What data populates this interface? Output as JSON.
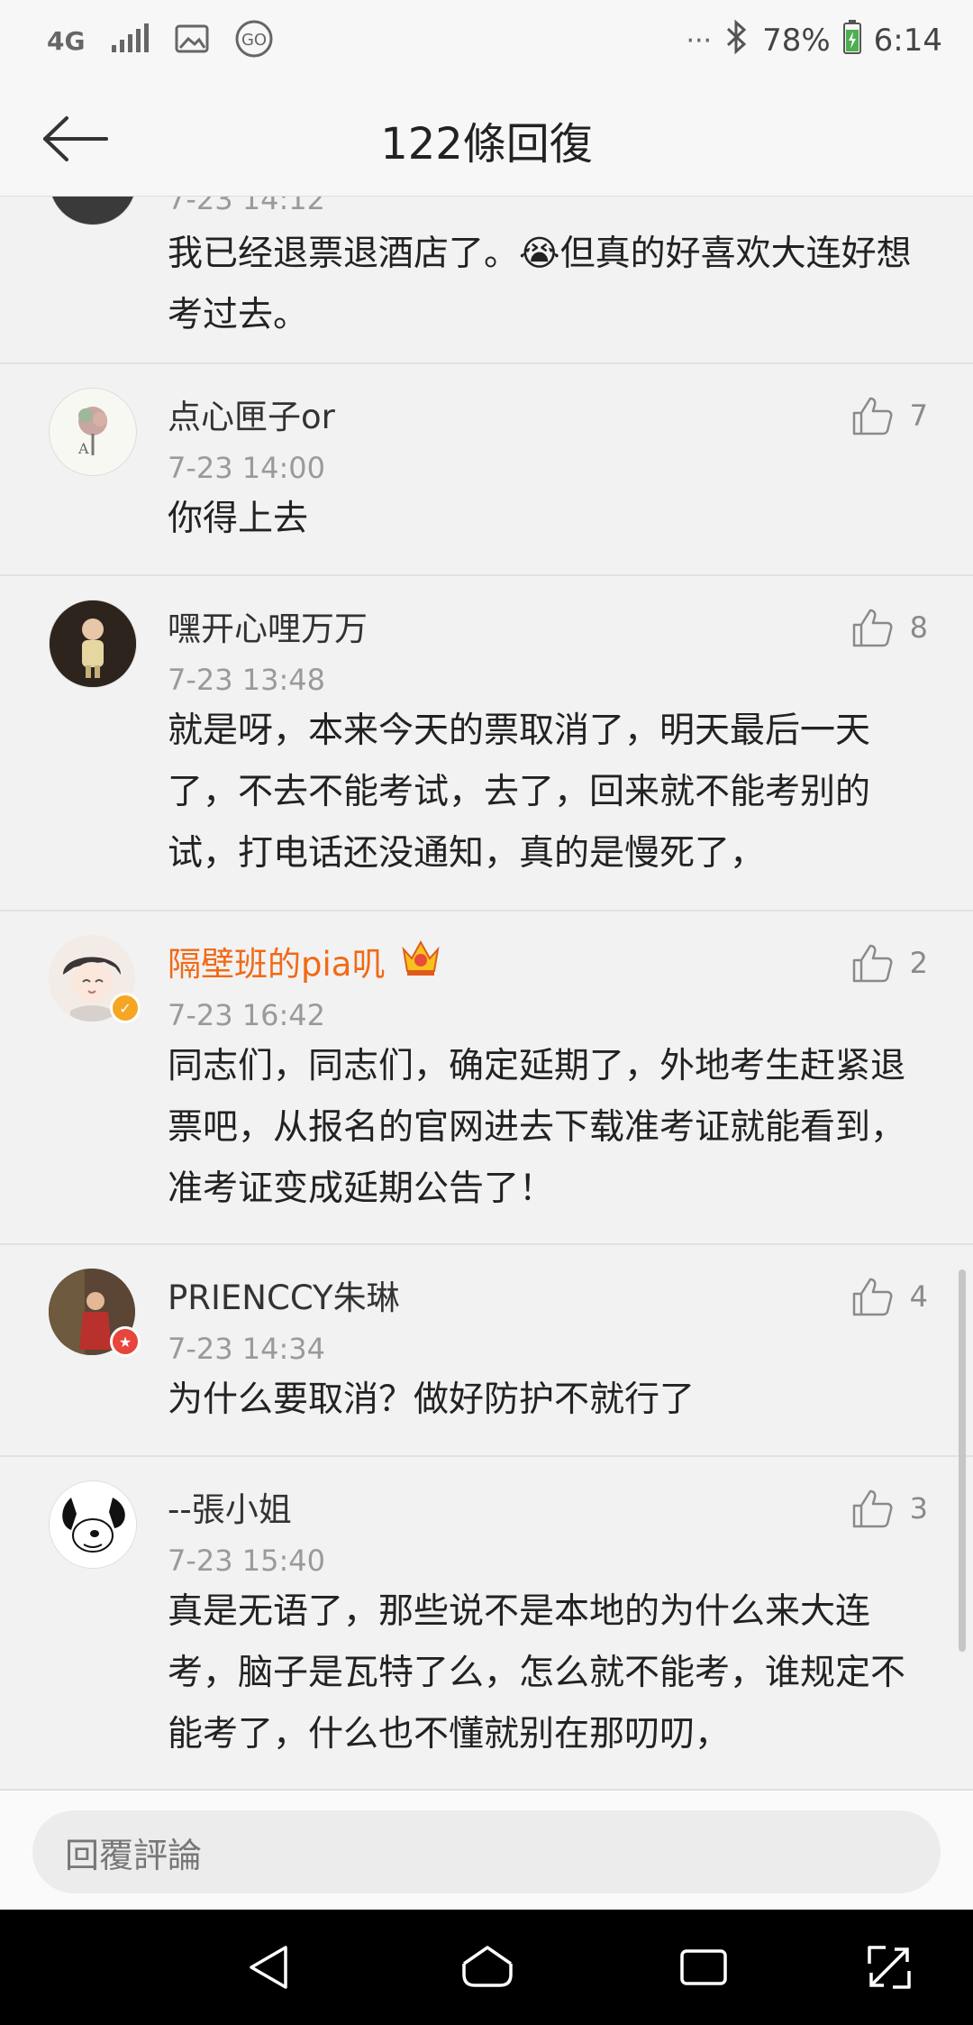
{
  "status_bar": {
    "network": "4G",
    "battery": "78%",
    "time": "6:14",
    "more": "···"
  },
  "header": {
    "title": "122條回復"
  },
  "comments": [
    {
      "name": "",
      "time": "7-23 14:12",
      "text": "我已经退票退酒店了。😭但真的好喜欢大连好想考过去。",
      "likes": ""
    },
    {
      "name": "点心匣子or",
      "time": "7-23 14:00",
      "text": "你得上去",
      "likes": "7"
    },
    {
      "name": "嘿开心哩万万",
      "time": "7-23 13:48",
      "text": "就是呀，本来今天的票取消了，明天最后一天了，不去不能考试，去了，回来就不能考别的试，打电话还没通知，真的是慢死了，",
      "likes": "8"
    },
    {
      "name": "隔壁班的pia叽",
      "time": "7-23 16:42",
      "text": "同志们，同志们，确定延期了，外地考生赶紧退票吧，从报名的官网进去下载准考证就能看到，准考证变成延期公告了！",
      "likes": "2"
    },
    {
      "name": "PRIENCCY朱琳",
      "time": "7-23 14:34",
      "text": "为什么要取消？做好防护不就行了",
      "likes": "4"
    },
    {
      "name": "--張小姐",
      "time": "7-23 15:40",
      "text": "真是无语了，那些说不是本地的为什么来大连考，脑子是瓦特了么，怎么就不能考，谁规定不能考了，什么也不懂就别在那叨叨，",
      "likes": "3"
    }
  ],
  "reply": {
    "placeholder": "回覆評論"
  },
  "colors": {
    "vip_name": "#f06a17",
    "verified_badge": "#f5a623",
    "member_badge": "#e8453c"
  }
}
